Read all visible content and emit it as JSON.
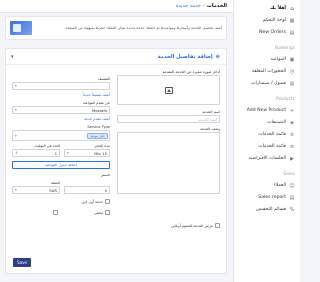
{
  "sidebar": {
    "items_top": [
      {
        "label": "أهلاً بك",
        "icon": "home-icon"
      },
      {
        "label": "لوحة التحكم",
        "icon": "dashboard-icon"
      },
      {
        "label": "New Orders",
        "icon": "orders-icon"
      }
    ],
    "bookings_heading": "Bookings",
    "bookings_items": [
      {
        "label": "المواعيد",
        "icon": "calendar-icon"
      },
      {
        "label": "الحجوزات المعلقة",
        "icon": "pending-icon"
      },
      {
        "label": "فصول / سيمنارات",
        "icon": "class-icon"
      }
    ],
    "products_heading": "Products",
    "products_items": [
      {
        "label": "Add New Product",
        "icon": "plus-icon"
      },
      {
        "label": "التصنيفات",
        "icon": "tag-icon"
      },
      {
        "label": "قائمة الخدمات",
        "icon": "list-icon"
      },
      {
        "label": "قائمة الخدمات",
        "icon": "list-icon"
      },
      {
        "label": "الجلسات الافتراضية",
        "icon": "video-icon"
      }
    ],
    "sales_heading": "Sales",
    "sales_items": [
      {
        "label": "العملاء",
        "icon": "users-icon"
      },
      {
        "label": "Sales report",
        "icon": "report-icon"
      },
      {
        "label": "قسائم التخفيض",
        "icon": "coupon-icon"
      }
    ]
  },
  "breadcrumb": {
    "root": "الخدمات",
    "sep": "›",
    "current": "خدمة جديدة"
  },
  "banner": {
    "text": "أضف تفاصيل الخدمة وأسعارها ومواعيدها ثم احفظ. خدمة جديدة يمكن للعملاء حجزها بسهولة من الصفحة."
  },
  "form": {
    "title": "إضافة تفاصيل الخدمة",
    "upload_label": "أدخل صورة مميزة عن الخدمة المقدمة",
    "name_label": "اسم الخدمة",
    "name_placeholder": "اسم الخدمة",
    "description_label": "وصف الخدمة",
    "category_label": "التصنيف",
    "category_link": "أضف تصنيفاً جديداً",
    "appointment_label": "عن مقدم المواعيد",
    "appointment_value": "Mostafa",
    "appointment_link": "أضف مقدم خدمة",
    "service_type_label": "Service Type",
    "service_type_tag": "حجز موعد",
    "duration_label": "مدة الحجز",
    "duration_value": "Min 15",
    "bookings_label": "العدد في التوقيت",
    "bookings_value": "1",
    "add_slot_button": "إضافة جدول المواعيد",
    "price_label": "السعر",
    "currency_label": "العملة",
    "currency_value": "SAR",
    "price_value": "0",
    "checkbox_online": "خدمة أون لاين",
    "checkbox_hidden": "مخفي",
    "checkbox_terms": "عرض الخدمة للعموم أونلاين",
    "save_button": "Save"
  }
}
